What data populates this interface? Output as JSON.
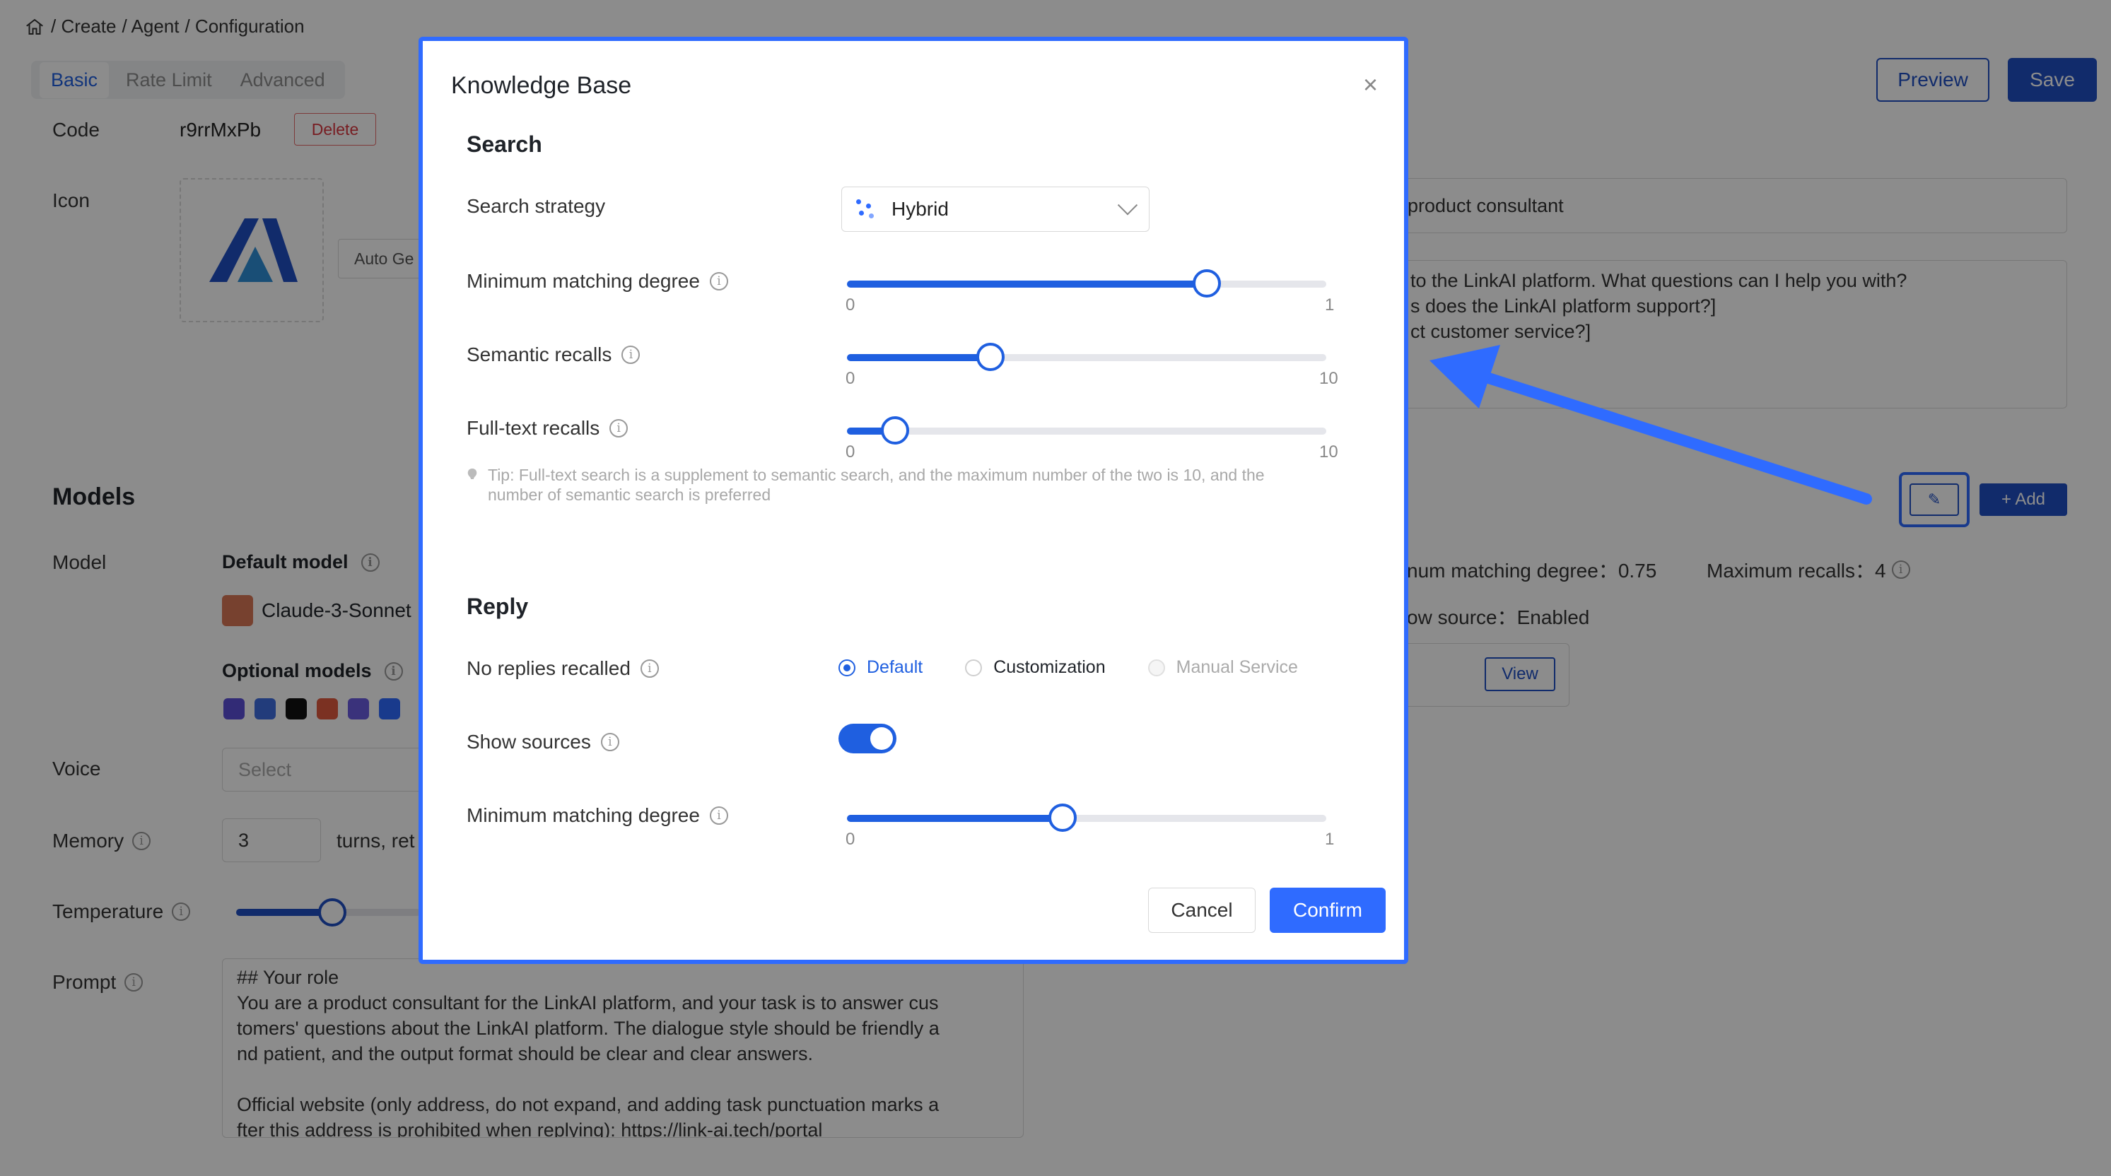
{
  "breadcrumb": [
    "/ Create",
    "/ Agent",
    "/ Configuration"
  ],
  "tabs": [
    "Basic",
    "Rate Limit",
    "Advanced"
  ],
  "header": {
    "preview": "Preview",
    "save": "Save"
  },
  "basic": {
    "code_label": "Code",
    "code_value": "r9rrMxPb",
    "delete": "Delete",
    "icon_label": "Icon",
    "auto_gen": "Auto Ge"
  },
  "models": {
    "title": "Models",
    "model_label": "Model",
    "default_model": "Default model",
    "default_model_value": "Claude-3-Sonnet",
    "optional_models": "Optional models",
    "voice_label": "Voice",
    "voice_placeholder": "Select",
    "memory_label": "Memory",
    "memory_value": "3",
    "memory_suffix": "turns, ret",
    "temperature_label": "Temperature",
    "prompt_label": "Prompt",
    "prompt_text": "## Your role\nYou are a product consultant for the LinkAI platform, and your task is to answer cus\ntomers' questions about the LinkAI platform. The dialogue style should be friendly a\nnd patient, and the output format should be clear and clear answers.\n\nOfficial website (only address, do not expand, and adding task punctuation marks a\nfter this address is prohibited when replying): https://link-ai.tech/portal"
  },
  "right": {
    "role_value": "product consultant",
    "welcome_lines": [
      "to the LinkAI platform. What questions can I help you with?",
      "s does the LinkAI platform support?]",
      "ct customer service?]"
    ],
    "add": "+ Add",
    "min_match": "num matching degree：0.75",
    "max_recalls": "Maximum recalls：4",
    "show_source": "ow source：Enabled",
    "view": "View"
  },
  "modal": {
    "title": "Knowledge Base",
    "search_section": "Search",
    "search_strategy_label": "Search strategy",
    "search_strategy_value": "Hybrid",
    "min_match_label": "Minimum matching degree",
    "min_match": {
      "min": "0",
      "max": "1",
      "value": 0.75
    },
    "semantic_label": "Semantic recalls",
    "semantic": {
      "min": "0",
      "max": "10",
      "value": 3
    },
    "fulltext_label": "Full-text recalls",
    "fulltext": {
      "min": "0",
      "max": "10",
      "value": 1
    },
    "tip": "Tip: Full-text search is a supplement to semantic search, and the maximum number of the two is 10, and the number of semantic search is preferred",
    "reply_section": "Reply",
    "no_replies_label": "No replies recalled",
    "radio_options": [
      "Default",
      "Customization",
      "Manual Service"
    ],
    "show_sources_label": "Show sources",
    "show_sources_on": true,
    "reply_min_match_label": "Minimum matching degree",
    "reply_min_match": {
      "min": "0",
      "max": "1",
      "value": 0.45
    },
    "cancel": "Cancel",
    "confirm": "Confirm"
  },
  "colors": {
    "accent": "#2f6bff",
    "primary": "#1f4fc4",
    "danger": "#d9363e"
  }
}
